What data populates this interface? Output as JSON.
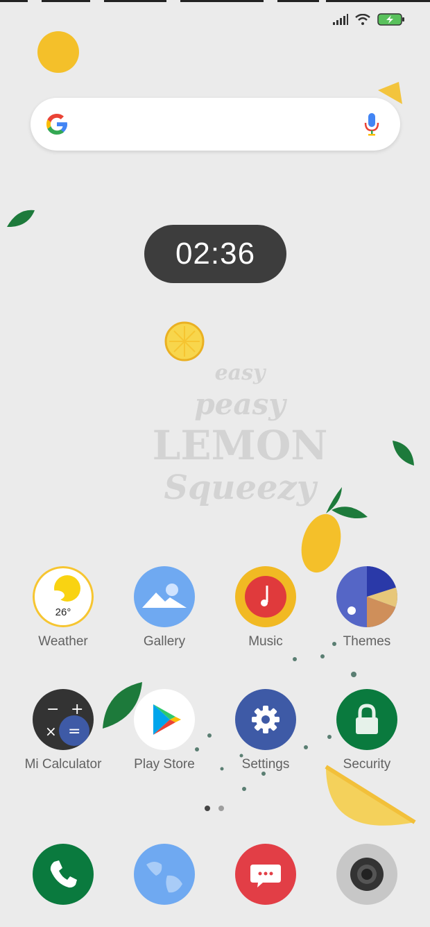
{
  "status_bar": {
    "signal_icon": "signal-icon",
    "wifi_icon": "wifi-icon",
    "battery_icon": "battery-charging-icon"
  },
  "search_bar": {
    "logo_icon": "google-g-icon",
    "voice_icon": "microphone-icon"
  },
  "clock": {
    "time": "02:36"
  },
  "wallpaper": {
    "line1": "easy",
    "line2": "peasy",
    "line3": "LEMON",
    "line4": "Squeezy"
  },
  "apps": {
    "row1": [
      {
        "label": "Weather",
        "temp": "26°"
      },
      {
        "label": "Gallery"
      },
      {
        "label": "Music"
      },
      {
        "label": "Themes"
      }
    ],
    "row2": [
      {
        "label": "Mi Calculator"
      },
      {
        "label": "Play Store"
      },
      {
        "label": "Settings"
      },
      {
        "label": "Security"
      }
    ]
  },
  "page_indicator": {
    "pages": 2,
    "current": 1
  },
  "dock": {
    "items": [
      {
        "icon": "phone-icon"
      },
      {
        "icon": "browser-icon"
      },
      {
        "icon": "messaging-icon"
      },
      {
        "icon": "camera-icon"
      }
    ]
  },
  "colors": {
    "accent_green": "#0a7a3e",
    "weather_ring": "#f6c531",
    "music_bg": "#f1b923",
    "music_inner": "#e03a3c",
    "settings_bg": "#3e5aa6",
    "messaging_bg": "#e23e46",
    "gallery_bg": "#6fa9f1",
    "background": "#ebebeb"
  }
}
